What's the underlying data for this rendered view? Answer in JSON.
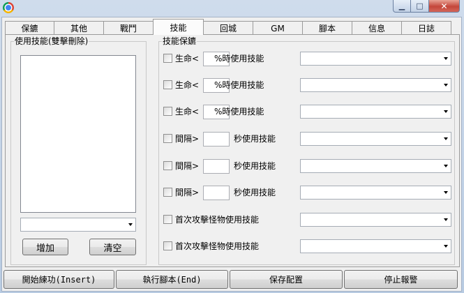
{
  "window": {
    "icons": {
      "app": "chrome-icon",
      "minimize": "minimize-icon",
      "maximize": "maximize-icon",
      "close": "close-icon"
    }
  },
  "tabs": [
    {
      "label": "保鑣",
      "selected": false
    },
    {
      "label": "其他",
      "selected": false
    },
    {
      "label": "戰鬥",
      "selected": false
    },
    {
      "label": "技能",
      "selected": true
    },
    {
      "label": "回城",
      "selected": false
    },
    {
      "label": "GM",
      "selected": false
    },
    {
      "label": "腳本",
      "selected": false
    },
    {
      "label": "信息",
      "selected": false
    },
    {
      "label": "日誌",
      "selected": false
    }
  ],
  "skill_list": {
    "title": "使用技能(雙擊刪除)",
    "items": [],
    "combo_value": "",
    "add_label": "增加",
    "clear_label": "清空"
  },
  "protect": {
    "title": "技能保鑣",
    "rows": [
      {
        "prefix": "生命<",
        "suffix": "%時使用技能",
        "has_input": true,
        "checked": false,
        "value": "",
        "skill": ""
      },
      {
        "prefix": "生命<",
        "suffix": "%時使用技能",
        "has_input": true,
        "checked": false,
        "value": "",
        "skill": ""
      },
      {
        "prefix": "生命<",
        "suffix": "%時使用技能",
        "has_input": true,
        "checked": false,
        "value": "",
        "skill": ""
      },
      {
        "prefix": "間隔>",
        "suffix": "秒使用技能",
        "has_input": true,
        "checked": false,
        "value": "",
        "skill": ""
      },
      {
        "prefix": "間隔>",
        "suffix": "秒使用技能",
        "has_input": true,
        "checked": false,
        "value": "",
        "skill": ""
      },
      {
        "prefix": "間隔>",
        "suffix": "秒使用技能",
        "has_input": true,
        "checked": false,
        "value": "",
        "skill": ""
      },
      {
        "prefix": "首次攻擊怪物使用技能",
        "suffix": "",
        "has_input": false,
        "checked": false,
        "value": "",
        "skill": ""
      },
      {
        "prefix": "首次攻擊怪物使用技能",
        "suffix": "",
        "has_input": false,
        "checked": false,
        "value": "",
        "skill": ""
      }
    ]
  },
  "bottom_buttons": [
    {
      "label": "開始練功(Insert)"
    },
    {
      "label": "執行腳本(End)"
    },
    {
      "label": "保存配置"
    },
    {
      "label": "停止報警"
    }
  ]
}
